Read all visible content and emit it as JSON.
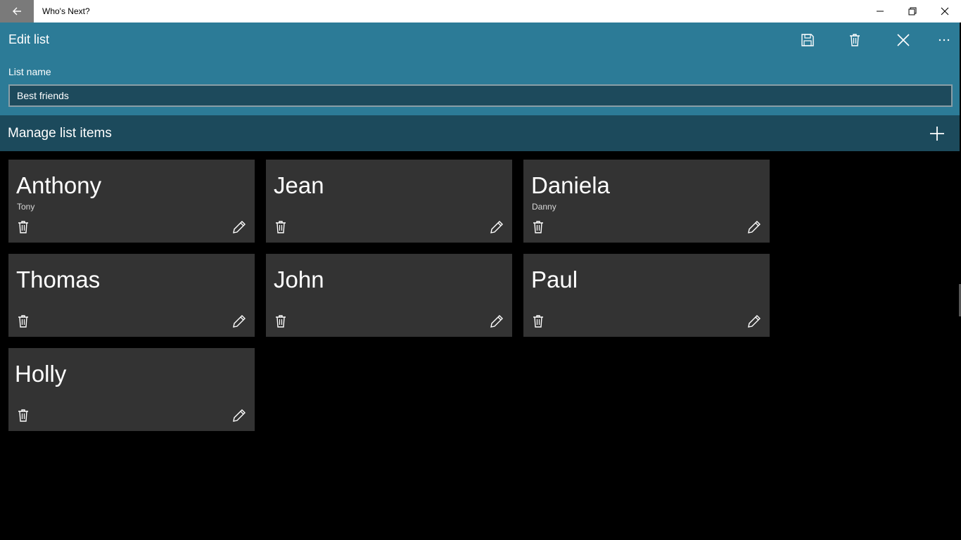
{
  "window": {
    "title": "Who's Next?",
    "icons": [
      "back-arrow-icon",
      "minimize-icon",
      "restore-icon",
      "close-icon"
    ]
  },
  "header": {
    "title": "Edit list",
    "commands": [
      "save-icon",
      "delete-icon",
      "close-icon",
      "more-icon"
    ],
    "field_label": "List name",
    "list_name_value": "Best friends",
    "color": "#2c7b97"
  },
  "manage": {
    "title": "Manage list items",
    "add_icon": "plus-icon",
    "color": "#1c4a5c"
  },
  "items": [
    {
      "name": "Anthony",
      "nickname": "Tony"
    },
    {
      "name": "Jean",
      "nickname": ""
    },
    {
      "name": "Daniela",
      "nickname": "Danny"
    },
    {
      "name": "Thomas",
      "nickname": ""
    },
    {
      "name": "John",
      "nickname": ""
    },
    {
      "name": "Paul",
      "nickname": ""
    },
    {
      "name": "Holly",
      "nickname": ""
    }
  ],
  "card_color": "#333333"
}
